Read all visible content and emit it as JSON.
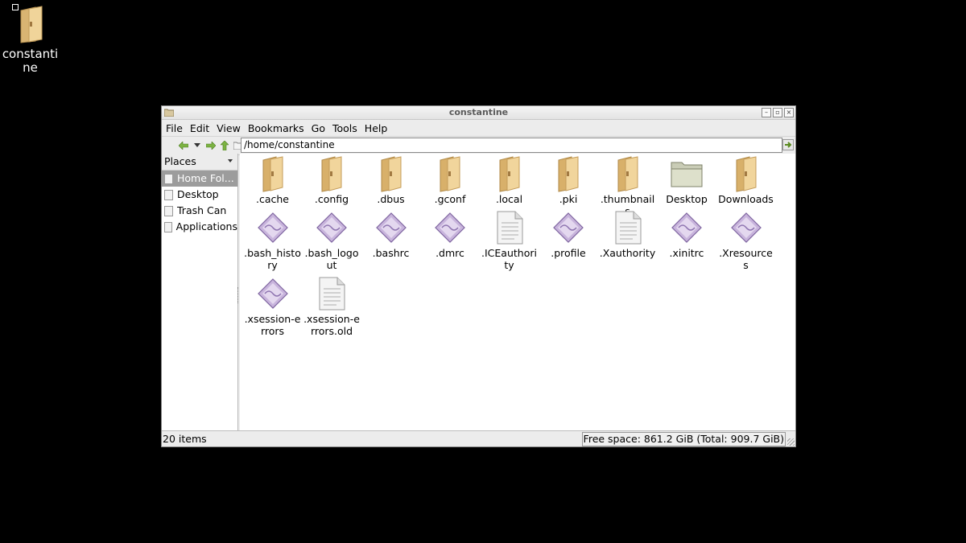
{
  "desktop": {
    "icon_label": "constantine"
  },
  "window": {
    "title": "constantine",
    "menu": [
      "File",
      "Edit",
      "View",
      "Bookmarks",
      "Go",
      "Tools",
      "Help"
    ],
    "path": "/home/constantine",
    "places_header": "Places",
    "places": [
      {
        "label": "Home Fol...",
        "selected": true
      },
      {
        "label": "Desktop",
        "selected": false
      },
      {
        "label": "Trash Can",
        "selected": false
      },
      {
        "label": "Applications",
        "selected": false
      }
    ],
    "items": [
      {
        "label": ".cache",
        "icon": "folder-icon"
      },
      {
        "label": ".config",
        "icon": "folder-icon"
      },
      {
        "label": ".dbus",
        "icon": "folder-icon"
      },
      {
        "label": ".gconf",
        "icon": "folder-icon"
      },
      {
        "label": ".local",
        "icon": "folder-icon"
      },
      {
        "label": ".pki",
        "icon": "folder-icon"
      },
      {
        "label": ".thumbnails",
        "icon": "folder-icon"
      },
      {
        "label": "Desktop",
        "icon": "desktop-folder-icon"
      },
      {
        "label": "Downloads",
        "icon": "folder-icon"
      },
      {
        "label": ".bash_history",
        "icon": "text-file-icon"
      },
      {
        "label": ".bash_logout",
        "icon": "text-file-icon"
      },
      {
        "label": ".bashrc",
        "icon": "text-file-icon"
      },
      {
        "label": ".dmrc",
        "icon": "text-file-icon"
      },
      {
        "label": ".ICEauthority",
        "icon": "document-icon"
      },
      {
        "label": ".profile",
        "icon": "text-file-icon"
      },
      {
        "label": ".Xauthority",
        "icon": "document-icon"
      },
      {
        "label": ".xinitrc",
        "icon": "text-file-icon"
      },
      {
        "label": ".Xresources",
        "icon": "text-file-icon"
      },
      {
        "label": ".xsession-errors",
        "icon": "text-file-icon"
      },
      {
        "label": ".xsession-errors.old",
        "icon": "document-icon"
      }
    ],
    "status_left": "20 items",
    "status_right": "Free space: 861.2 GiB (Total: 909.7 GiB)"
  },
  "colors": {
    "desktop_bg": "#000000",
    "folder": "#e8c88a",
    "selection": "#9c9c9c",
    "text_file": "#a98ec4"
  }
}
